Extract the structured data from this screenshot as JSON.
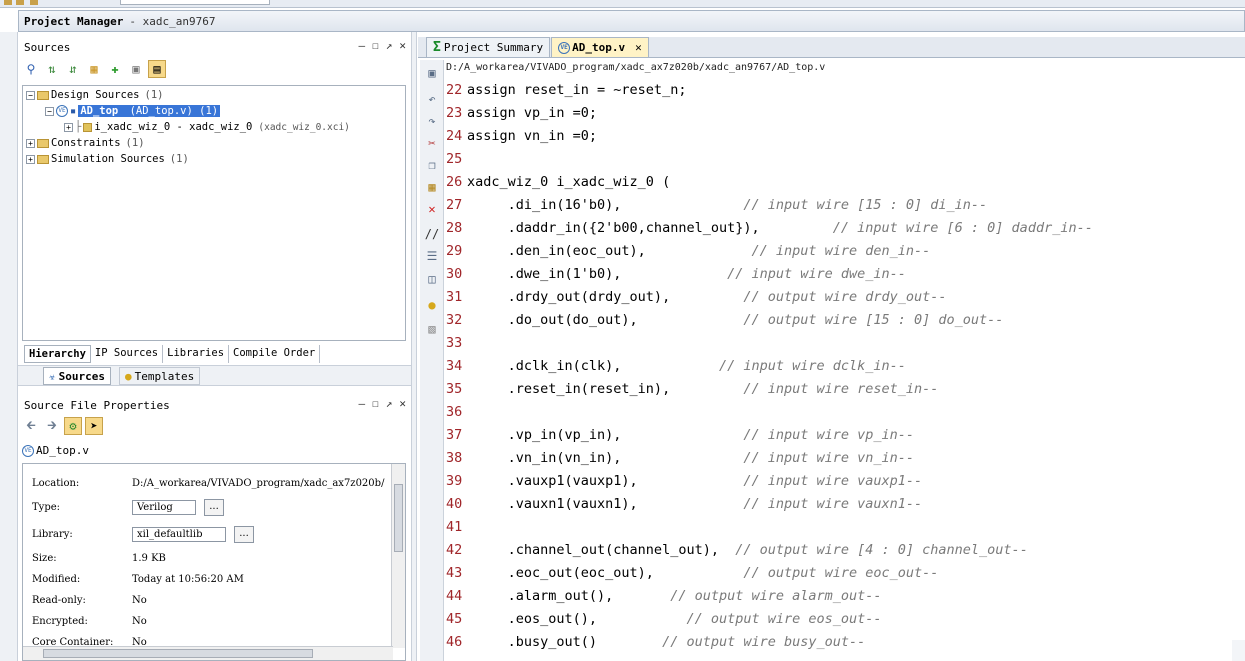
{
  "project_manager": {
    "title": "Project Manager",
    "project": "- xadc_an9767"
  },
  "window_controls": {
    "minimize": "—",
    "maximize": "☐",
    "restore": "↗",
    "close": "✕"
  },
  "sources_panel": {
    "title": "Sources",
    "toolbar_icons": [
      "search-icon",
      "collapse-all-icon",
      "expand-all-icon",
      "add-sources-icon",
      "add-hierarchy-icon",
      "properties-icon",
      "show-hierarchy-icon"
    ],
    "tree": {
      "design_sources": "Design Sources",
      "design_sources_count": "(1)",
      "top_module": "AD_top",
      "top_module_detail": "(AD_top.v) (1)",
      "ip_instance": "i_xadc_wiz_0 - xadc_wiz_0",
      "ip_file": "(xadc_wiz_0.xci)",
      "constraints": "Constraints",
      "constraints_count": "(1)",
      "simulation_sources": "Simulation Sources",
      "simulation_sources_count": "(1)"
    },
    "tabs": [
      "Hierarchy",
      "IP Sources",
      "Libraries",
      "Compile Order"
    ],
    "subtabs": [
      "Sources",
      "Templates"
    ]
  },
  "file_properties": {
    "title": "Source File Properties",
    "file_name": "AD_top.v",
    "rows": {
      "location_label": "Location:",
      "location_value": "D:/A_workarea/VIVADO_program/xadc_ax7z020b/",
      "type_label": "Type:",
      "type_value": "Verilog",
      "library_label": "Library:",
      "library_value": "xil_defaultlib",
      "size_label": "Size:",
      "size_value": "1.9 KB",
      "modified_label": "Modified:",
      "modified_value": "Today at 10:56:20 AM",
      "readonly_label": "Read-only:",
      "readonly_value": "No",
      "encrypted_label": "Encrypted:",
      "encrypted_value": "No",
      "core_label": "Core Container:",
      "core_value": "No"
    },
    "browse_label": "..."
  },
  "editor": {
    "tabs": {
      "summary": "Project Summary",
      "file": "AD_top.v"
    },
    "path": "D:/A_workarea/VIVADO_program/xadc_ax7z020b/xadc_an9767/AD_top.v",
    "lines": [
      {
        "n": "22",
        "code": "assign reset_in = ~reset_n;",
        "comment": ""
      },
      {
        "n": "23",
        "code": "assign vp_in =0;",
        "comment": ""
      },
      {
        "n": "24",
        "code": "assign vn_in =0;",
        "comment": ""
      },
      {
        "n": "25",
        "code": "",
        "comment": ""
      },
      {
        "n": "26",
        "code": "xadc_wiz_0 i_xadc_wiz_0 (",
        "comment": ""
      },
      {
        "n": "27",
        "code": "     .di_in(16'b0),               ",
        "comment": "// input wire [15 : 0] di_in--"
      },
      {
        "n": "28",
        "code": "     .daddr_in({2'b00,channel_out}),         ",
        "comment": "// input wire [6 : 0] daddr_in--"
      },
      {
        "n": "29",
        "code": "     .den_in(eoc_out),             ",
        "comment": "// input wire den_in--"
      },
      {
        "n": "30",
        "code": "     .dwe_in(1'b0),             ",
        "comment": "// input wire dwe_in--"
      },
      {
        "n": "31",
        "code": "     .drdy_out(drdy_out),         ",
        "comment": "// output wire drdy_out--"
      },
      {
        "n": "32",
        "code": "     .do_out(do_out),             ",
        "comment": "// output wire [15 : 0] do_out--"
      },
      {
        "n": "33",
        "code": "",
        "comment": ""
      },
      {
        "n": "34",
        "code": "     .dclk_in(clk),            ",
        "comment": "// input wire dclk_in--"
      },
      {
        "n": "35",
        "code": "     .reset_in(reset_in),         ",
        "comment": "// input wire reset_in--"
      },
      {
        "n": "36",
        "code": "",
        "comment": ""
      },
      {
        "n": "37",
        "code": "     .vp_in(vp_in),               ",
        "comment": "// input wire vp_in--"
      },
      {
        "n": "38",
        "code": "     .vn_in(vn_in),               ",
        "comment": "// input wire vn_in--"
      },
      {
        "n": "39",
        "code": "     .vauxp1(vauxp1),             ",
        "comment": "// input wire vauxp1--"
      },
      {
        "n": "40",
        "code": "     .vauxn1(vauxn1),             ",
        "comment": "// input wire vauxn1--"
      },
      {
        "n": "41",
        "code": "",
        "comment": ""
      },
      {
        "n": "42",
        "code": "     .channel_out(channel_out),  ",
        "comment": "// output wire [4 : 0] channel_out--"
      },
      {
        "n": "43",
        "code": "     .eoc_out(eoc_out),           ",
        "comment": "// output wire eoc_out--"
      },
      {
        "n": "44",
        "code": "     .alarm_out(),       ",
        "comment": "// output wire alarm_out--"
      },
      {
        "n": "45",
        "code": "     .eos_out(),           ",
        "comment": "// output wire eos_out--"
      },
      {
        "n": "46",
        "code": "     .busy_out()        ",
        "comment": "// output wire busy_out--"
      }
    ]
  }
}
